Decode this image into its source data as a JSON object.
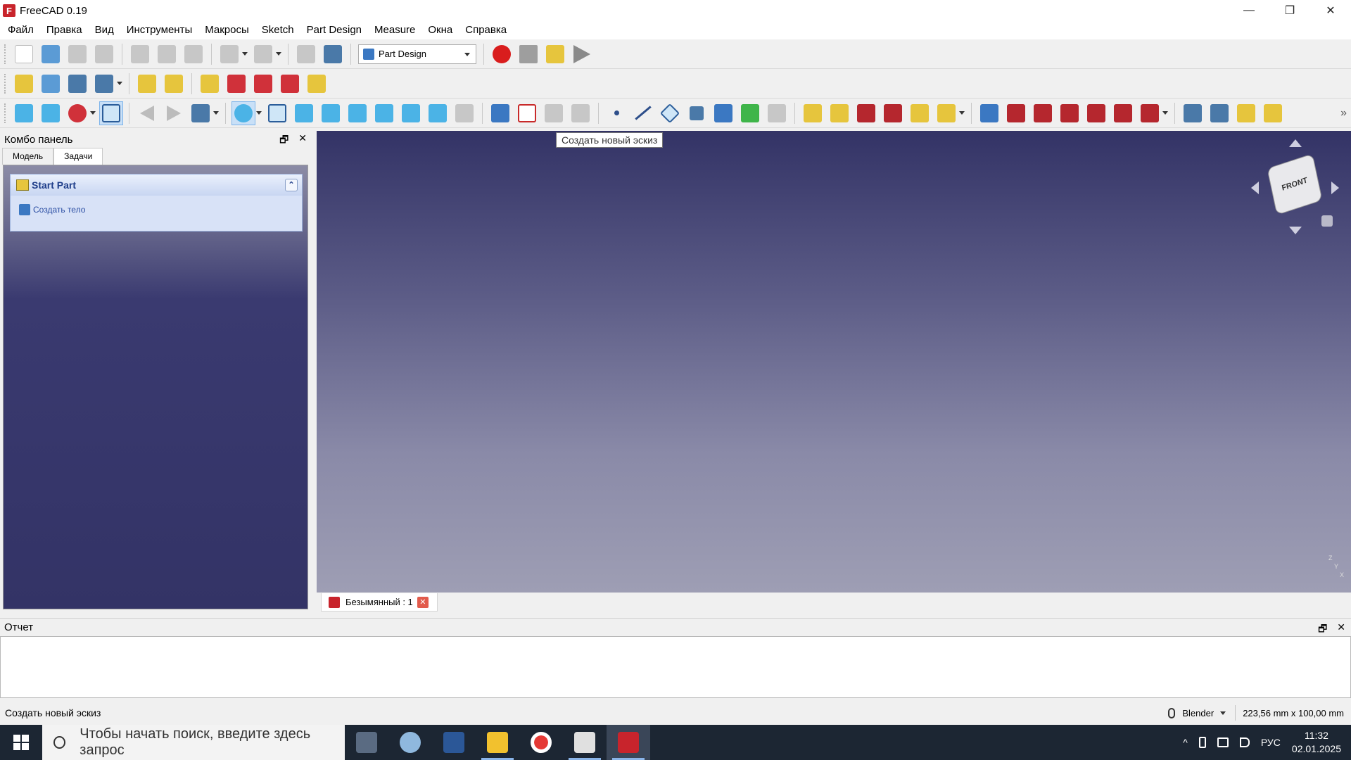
{
  "window": {
    "title": "FreeCAD 0.19",
    "app_icon_letter": "F",
    "minimize": "—",
    "maximize": "❐",
    "close": "✕"
  },
  "menu": [
    "Файл",
    "Правка",
    "Вид",
    "Инструменты",
    "Макросы",
    "Sketch",
    "Part Design",
    "Measure",
    "Окна",
    "Справка"
  ],
  "toolbar": {
    "workbench_selected": "Part Design",
    "more": "»"
  },
  "tooltip": "Создать новый эскиз",
  "combo": {
    "title": "Комбо панель",
    "tabs": [
      "Модель",
      "Задачи"
    ],
    "selected_tab": "Задачи",
    "task_title": "Start Part",
    "task_link": "Создать тело",
    "float_btn": "🗗",
    "close_btn": "✕",
    "collapse_btn": "⌃"
  },
  "view3d": {
    "navcube_face": "FRONT",
    "axis_labels": [
      "Z",
      "Y",
      "X"
    ]
  },
  "doc_tab": {
    "label": "Безымянный : 1",
    "close": "✕"
  },
  "report": {
    "title": "Отчет",
    "float_btn": "🗗",
    "close_btn": "✕"
  },
  "statusbar": {
    "message": "Создать новый эскиз",
    "nav_style": "Blender",
    "dimensions": "223,56 mm x 100,00 mm"
  },
  "taskbar": {
    "search_placeholder": "Чтобы начать поиск, введите здесь запрос",
    "language": "РУС",
    "time": "11:32",
    "date": "02.01.2025",
    "tray_chevron": "^"
  },
  "colors": {
    "view_top": "#333366",
    "view_bottom": "#9e9eb4",
    "taskbar": "#1c2633",
    "record": "#d91d1d"
  }
}
